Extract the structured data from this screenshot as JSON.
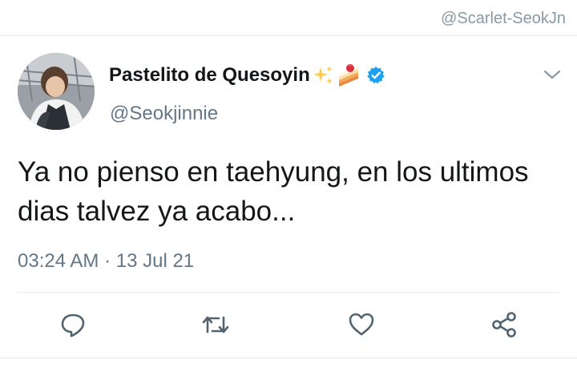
{
  "watermark": "@Scarlet-SeokJn",
  "tweet": {
    "display_name": "Pastelito de Quesoyin",
    "name_emojis": [
      "sparkles-emoji",
      "shortcake-emoji"
    ],
    "verified": true,
    "handle": "@Seokjinnie",
    "text": "Ya no pienso en taehyung, en los ultimos dias talvez ya acabo...",
    "timestamp": "03:24 AM · 13 Jul 21"
  },
  "actions": [
    {
      "name": "reply",
      "icon": "reply-icon"
    },
    {
      "name": "retweet",
      "icon": "retweet-icon"
    },
    {
      "name": "like",
      "icon": "heart-icon"
    },
    {
      "name": "share",
      "icon": "share-icon"
    }
  ],
  "colors": {
    "text": "#14171a",
    "secondary": "#657786",
    "icon": "#536471",
    "verified": "#1da1f2",
    "divider": "#e6ecf0"
  }
}
